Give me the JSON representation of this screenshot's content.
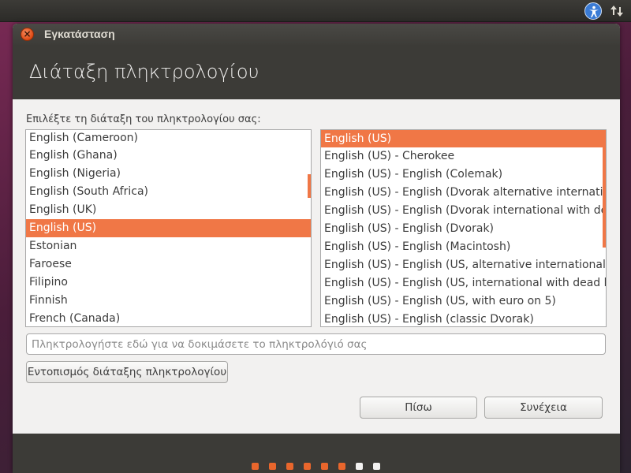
{
  "panel": {
    "accessibility_icon": "accessibility-icon",
    "network_icon": "network-transfer-icon"
  },
  "window": {
    "title": "Εγκατάσταση",
    "close_icon": "close-icon"
  },
  "header": {
    "title": "Διάταξη πληκτρολογίου"
  },
  "main": {
    "prompt": "Επιλέξτε τη διάταξη του πληκτρολογίου σας:",
    "layouts": [
      "English (Cameroon)",
      "English (Ghana)",
      "English (Nigeria)",
      "English (South Africa)",
      "English (UK)",
      "English (US)",
      "Estonian",
      "Faroese",
      "Filipino",
      "Finnish",
      "French (Canada)"
    ],
    "selected_layout": "English (US)",
    "variants": [
      "English (US)",
      "English (US) - Cherokee",
      "English (US) - English (Colemak)",
      "English (US) - English (Dvorak alternative international",
      "English (US) - English (Dvorak international with dead",
      "English (US) - English (Dvorak)",
      "English (US) - English (Macintosh)",
      "English (US) - English (US, alternative international)",
      "English (US) - English (US, international with dead keys",
      "English (US) - English (US, with euro on 5)",
      "English (US) - English (classic Dvorak)"
    ],
    "selected_variant": "English (US)",
    "test_placeholder": "Πληκτρολογήστε εδώ για να δοκιμάσετε το πληκτρολόγιό σας",
    "detect_button": "Εντοπισμός διάταξης πληκτρολογίου",
    "back_button": "Πίσω",
    "continue_button": "Συνέχεια"
  },
  "progress": {
    "total_steps": 8,
    "completed_steps": 6
  },
  "colors": {
    "accent": "#f07746",
    "step_done": "#e9662c",
    "step_pending": "#f2f1f0",
    "header_bg": "#3c3b37"
  }
}
